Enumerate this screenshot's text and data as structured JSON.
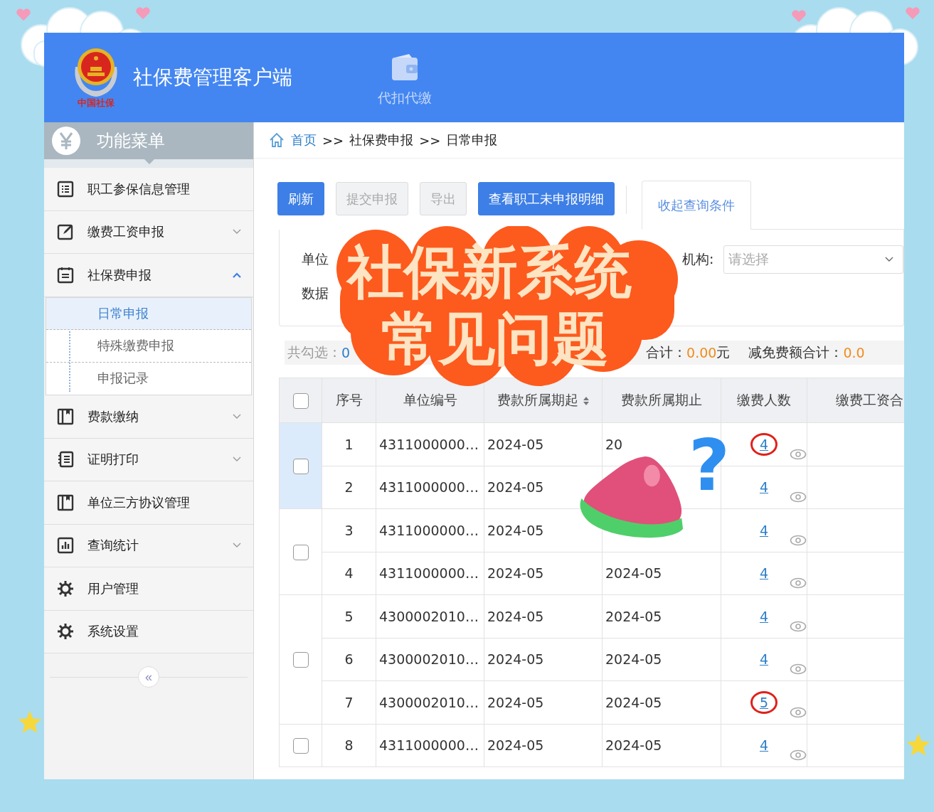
{
  "header": {
    "title": "社保费管理客户端",
    "logo_caption": "中国社保",
    "nav": [
      {
        "label": "代扣代缴"
      }
    ]
  },
  "sidebar": {
    "title": "功能菜单",
    "items": [
      {
        "label": "职工参保信息管理"
      },
      {
        "label": "缴费工资申报",
        "expanded": false
      },
      {
        "label": "社保费申报",
        "expanded": true,
        "children": [
          {
            "label": "日常申报",
            "selected": true
          },
          {
            "label": "特殊缴费申报",
            "selected": false
          },
          {
            "label": "申报记录",
            "selected": false
          }
        ]
      },
      {
        "label": "费款缴纳",
        "expanded": false
      },
      {
        "label": "证明打印",
        "expanded": false
      },
      {
        "label": "单位三方协议管理"
      },
      {
        "label": "查询统计",
        "expanded": false
      },
      {
        "label": "用户管理"
      },
      {
        "label": "系统设置"
      }
    ],
    "collapse": "«"
  },
  "breadcrumb": [
    {
      "label": "首页",
      "kind": "link"
    },
    {
      "label": ">>",
      "kind": "separator"
    },
    {
      "label": "社保费申报",
      "kind": "text"
    },
    {
      "label": ">>",
      "kind": "separator"
    },
    {
      "label": "日常申报",
      "kind": "text"
    }
  ],
  "toolbar": {
    "buttons": [
      {
        "label": "刷新",
        "kind": "primary"
      },
      {
        "label": "提交申报",
        "kind": "disabled"
      },
      {
        "label": "导出",
        "kind": "disabled"
      },
      {
        "label": "查看职工未申报明细",
        "kind": "primary"
      }
    ],
    "tab": {
      "label": "收起查询条件",
      "selected": true
    }
  },
  "filters": {
    "unit_label": "单位",
    "org_label": "机构:",
    "org_select": {
      "placeholder": "请选择"
    },
    "data_label": "数据"
  },
  "summary": [
    {
      "label": "共勾选：",
      "value": "0",
      "kind": "count"
    },
    {
      "label": "合计：",
      "value": "0.00",
      "unit": "元",
      "kind": "amount"
    },
    {
      "label": "减免费额合计：",
      "value": "0.0",
      "kind": "amount"
    }
  ],
  "table": {
    "header_checked": false,
    "columns": [
      {
        "label": "序号"
      },
      {
        "label": "单位编号"
      },
      {
        "label": "费款所属期起",
        "sortable": true
      },
      {
        "label": "费款所属期止"
      },
      {
        "label": "缴费人数"
      },
      {
        "label": "缴费工资合"
      }
    ],
    "groups": [
      {
        "selected": true,
        "checked": false,
        "rows": [
          {
            "index": "1",
            "unit": "4311000000…",
            "start": "2024-05",
            "end": "20",
            "count": "4",
            "circled": true
          },
          {
            "index": "2",
            "unit": "4311000000…",
            "start": "2024-05",
            "count": "4",
            "circled": false
          }
        ]
      },
      {
        "selected": false,
        "checked": false,
        "rows": [
          {
            "index": "3",
            "unit": "4311000000…",
            "start": "2024-05",
            "count": "4",
            "circled": false
          },
          {
            "index": "4",
            "unit": "4311000000…",
            "start": "2024-05",
            "end": "2024-05",
            "count": "4",
            "circled": false
          }
        ]
      },
      {
        "selected": false,
        "checked": false,
        "rows": [
          {
            "index": "5",
            "unit": "4300002010…",
            "start": "2024-05",
            "end": "2024-05",
            "count": "4",
            "circled": false
          },
          {
            "index": "6",
            "unit": "4300002010…",
            "start": "2024-05",
            "end": "2024-05",
            "count": "4",
            "circled": false
          },
          {
            "index": "7",
            "unit": "4300002010…",
            "start": "2024-05",
            "end": "2024-05",
            "count": "5",
            "circled": true
          }
        ]
      },
      {
        "selected": false,
        "checked": false,
        "rows": [
          {
            "index": "8",
            "unit": "4311000000…",
            "start": "2024-05",
            "end": "2024-05",
            "count": "4",
            "circled": false
          }
        ]
      }
    ]
  },
  "overlay": {
    "banner": [
      "社保新系统",
      "常见问题"
    ],
    "question": "?"
  }
}
